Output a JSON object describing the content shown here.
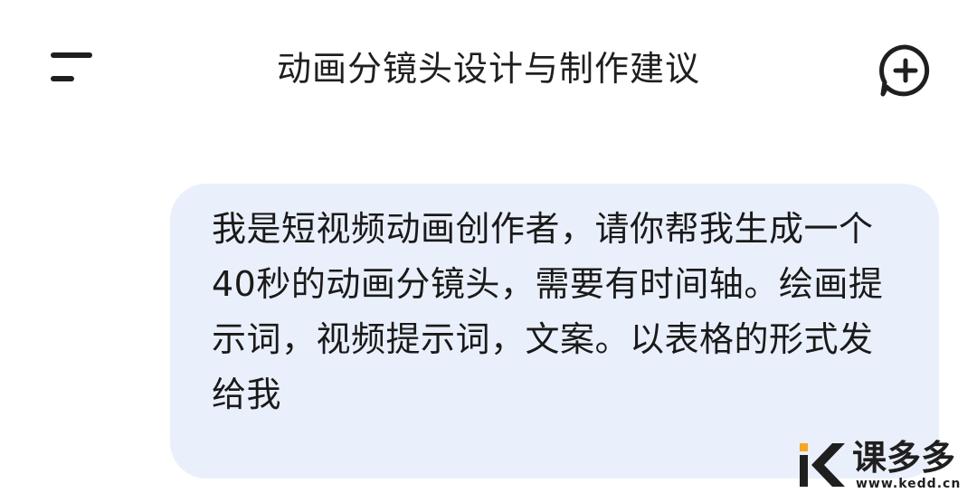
{
  "header": {
    "title": "动画分镜头设计与制作建议",
    "menu_icon": "menu-icon",
    "new_chat_icon": "new-chat-icon"
  },
  "message": {
    "text": "我是短视频动画创作者，请你帮我生成一个40秒的动画分镜头，需要有时间轴。绘画提示词，视频提示词，文案。以表格的形式发给我"
  },
  "watermark": {
    "name": "课多多",
    "url": "www.kedd.cn",
    "logo_icon": "kedd-logo-icon"
  },
  "colors": {
    "background": "#ffffff",
    "bubble": "#eaf0fb",
    "text": "#1a1a1a",
    "icon": "#1f1f1f",
    "logo_accent": "#f5a623"
  }
}
